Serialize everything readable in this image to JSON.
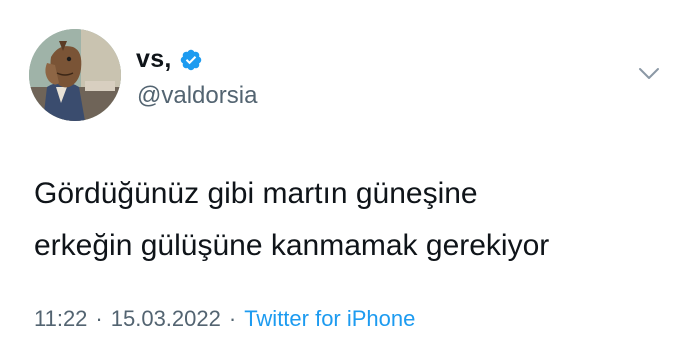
{
  "author": {
    "display_name": "vs,",
    "handle": "@valdorsia",
    "verified": true,
    "avatar_icon": "bojack-horseman-avatar"
  },
  "tweet": {
    "text_lines": [
      "Gördüğünüz gibi martın güneşine",
      "erkeğin gülüşüne kanmamak gerekiyor"
    ]
  },
  "meta": {
    "time": "11:22",
    "separator": "·",
    "date": "15.03.2022",
    "source": "Twitter for iPhone"
  },
  "icons": {
    "verified": "verified-badge-icon",
    "more": "chevron-down-icon"
  },
  "colors": {
    "text": "#0f1419",
    "secondary": "#536471",
    "accent": "#1d9bf0"
  }
}
